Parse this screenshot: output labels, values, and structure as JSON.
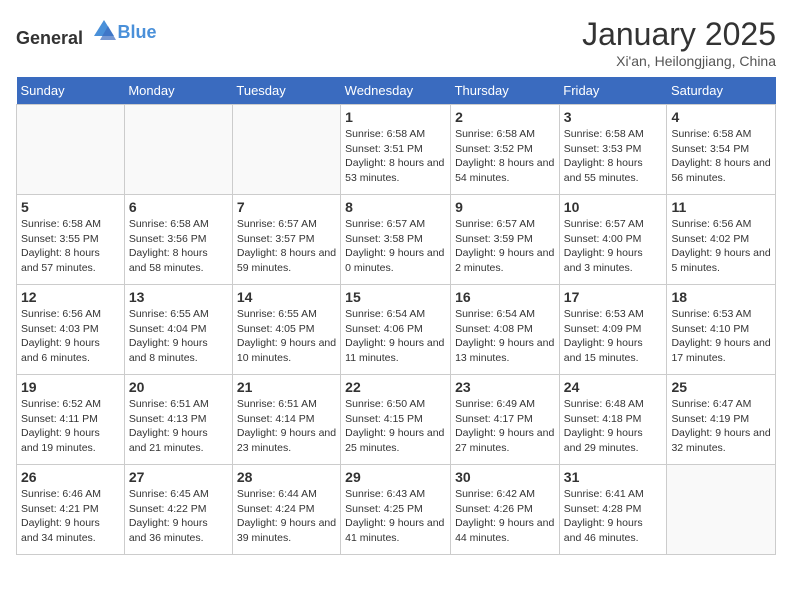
{
  "header": {
    "logo_general": "General",
    "logo_blue": "Blue",
    "month_title": "January 2025",
    "subtitle": "Xi'an, Heilongjiang, China"
  },
  "days_of_week": [
    "Sunday",
    "Monday",
    "Tuesday",
    "Wednesday",
    "Thursday",
    "Friday",
    "Saturday"
  ],
  "weeks": [
    [
      {
        "day": "",
        "content": ""
      },
      {
        "day": "",
        "content": ""
      },
      {
        "day": "",
        "content": ""
      },
      {
        "day": "1",
        "content": "Sunrise: 6:58 AM\nSunset: 3:51 PM\nDaylight: 8 hours and 53 minutes."
      },
      {
        "day": "2",
        "content": "Sunrise: 6:58 AM\nSunset: 3:52 PM\nDaylight: 8 hours and 54 minutes."
      },
      {
        "day": "3",
        "content": "Sunrise: 6:58 AM\nSunset: 3:53 PM\nDaylight: 8 hours and 55 minutes."
      },
      {
        "day": "4",
        "content": "Sunrise: 6:58 AM\nSunset: 3:54 PM\nDaylight: 8 hours and 56 minutes."
      }
    ],
    [
      {
        "day": "5",
        "content": "Sunrise: 6:58 AM\nSunset: 3:55 PM\nDaylight: 8 hours and 57 minutes."
      },
      {
        "day": "6",
        "content": "Sunrise: 6:58 AM\nSunset: 3:56 PM\nDaylight: 8 hours and 58 minutes."
      },
      {
        "day": "7",
        "content": "Sunrise: 6:57 AM\nSunset: 3:57 PM\nDaylight: 8 hours and 59 minutes."
      },
      {
        "day": "8",
        "content": "Sunrise: 6:57 AM\nSunset: 3:58 PM\nDaylight: 9 hours and 0 minutes."
      },
      {
        "day": "9",
        "content": "Sunrise: 6:57 AM\nSunset: 3:59 PM\nDaylight: 9 hours and 2 minutes."
      },
      {
        "day": "10",
        "content": "Sunrise: 6:57 AM\nSunset: 4:00 PM\nDaylight: 9 hours and 3 minutes."
      },
      {
        "day": "11",
        "content": "Sunrise: 6:56 AM\nSunset: 4:02 PM\nDaylight: 9 hours and 5 minutes."
      }
    ],
    [
      {
        "day": "12",
        "content": "Sunrise: 6:56 AM\nSunset: 4:03 PM\nDaylight: 9 hours and 6 minutes."
      },
      {
        "day": "13",
        "content": "Sunrise: 6:55 AM\nSunset: 4:04 PM\nDaylight: 9 hours and 8 minutes."
      },
      {
        "day": "14",
        "content": "Sunrise: 6:55 AM\nSunset: 4:05 PM\nDaylight: 9 hours and 10 minutes."
      },
      {
        "day": "15",
        "content": "Sunrise: 6:54 AM\nSunset: 4:06 PM\nDaylight: 9 hours and 11 minutes."
      },
      {
        "day": "16",
        "content": "Sunrise: 6:54 AM\nSunset: 4:08 PM\nDaylight: 9 hours and 13 minutes."
      },
      {
        "day": "17",
        "content": "Sunrise: 6:53 AM\nSunset: 4:09 PM\nDaylight: 9 hours and 15 minutes."
      },
      {
        "day": "18",
        "content": "Sunrise: 6:53 AM\nSunset: 4:10 PM\nDaylight: 9 hours and 17 minutes."
      }
    ],
    [
      {
        "day": "19",
        "content": "Sunrise: 6:52 AM\nSunset: 4:11 PM\nDaylight: 9 hours and 19 minutes."
      },
      {
        "day": "20",
        "content": "Sunrise: 6:51 AM\nSunset: 4:13 PM\nDaylight: 9 hours and 21 minutes."
      },
      {
        "day": "21",
        "content": "Sunrise: 6:51 AM\nSunset: 4:14 PM\nDaylight: 9 hours and 23 minutes."
      },
      {
        "day": "22",
        "content": "Sunrise: 6:50 AM\nSunset: 4:15 PM\nDaylight: 9 hours and 25 minutes."
      },
      {
        "day": "23",
        "content": "Sunrise: 6:49 AM\nSunset: 4:17 PM\nDaylight: 9 hours and 27 minutes."
      },
      {
        "day": "24",
        "content": "Sunrise: 6:48 AM\nSunset: 4:18 PM\nDaylight: 9 hours and 29 minutes."
      },
      {
        "day": "25",
        "content": "Sunrise: 6:47 AM\nSunset: 4:19 PM\nDaylight: 9 hours and 32 minutes."
      }
    ],
    [
      {
        "day": "26",
        "content": "Sunrise: 6:46 AM\nSunset: 4:21 PM\nDaylight: 9 hours and 34 minutes."
      },
      {
        "day": "27",
        "content": "Sunrise: 6:45 AM\nSunset: 4:22 PM\nDaylight: 9 hours and 36 minutes."
      },
      {
        "day": "28",
        "content": "Sunrise: 6:44 AM\nSunset: 4:24 PM\nDaylight: 9 hours and 39 minutes."
      },
      {
        "day": "29",
        "content": "Sunrise: 6:43 AM\nSunset: 4:25 PM\nDaylight: 9 hours and 41 minutes."
      },
      {
        "day": "30",
        "content": "Sunrise: 6:42 AM\nSunset: 4:26 PM\nDaylight: 9 hours and 44 minutes."
      },
      {
        "day": "31",
        "content": "Sunrise: 6:41 AM\nSunset: 4:28 PM\nDaylight: 9 hours and 46 minutes."
      },
      {
        "day": "",
        "content": ""
      }
    ]
  ]
}
